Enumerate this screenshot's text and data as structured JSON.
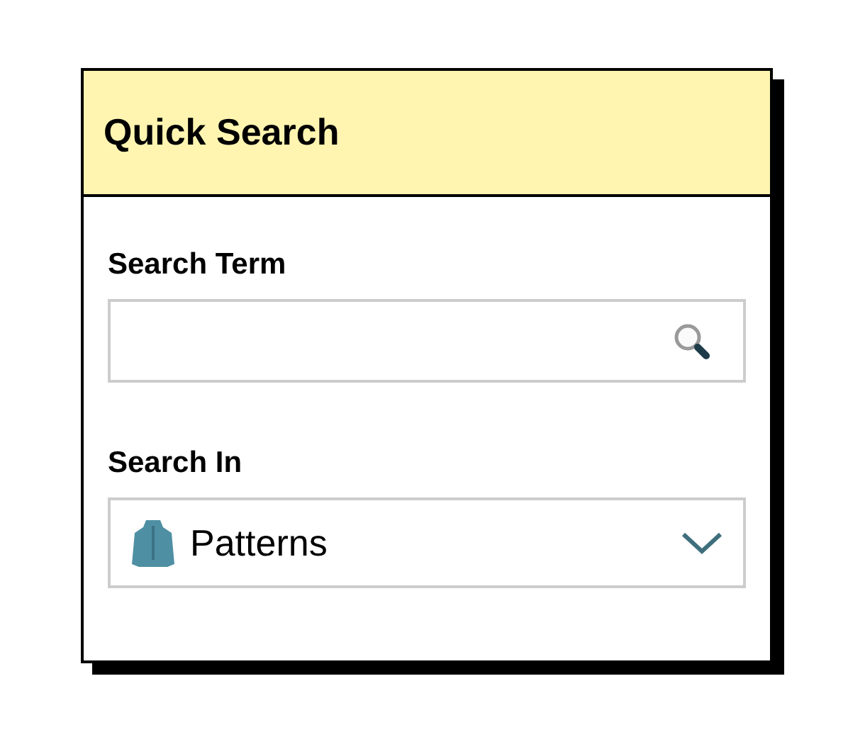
{
  "panel": {
    "title": "Quick Search"
  },
  "search_term": {
    "label": "Search Term"
  },
  "search_in": {
    "label": "Search In",
    "value": "Patterns"
  }
}
